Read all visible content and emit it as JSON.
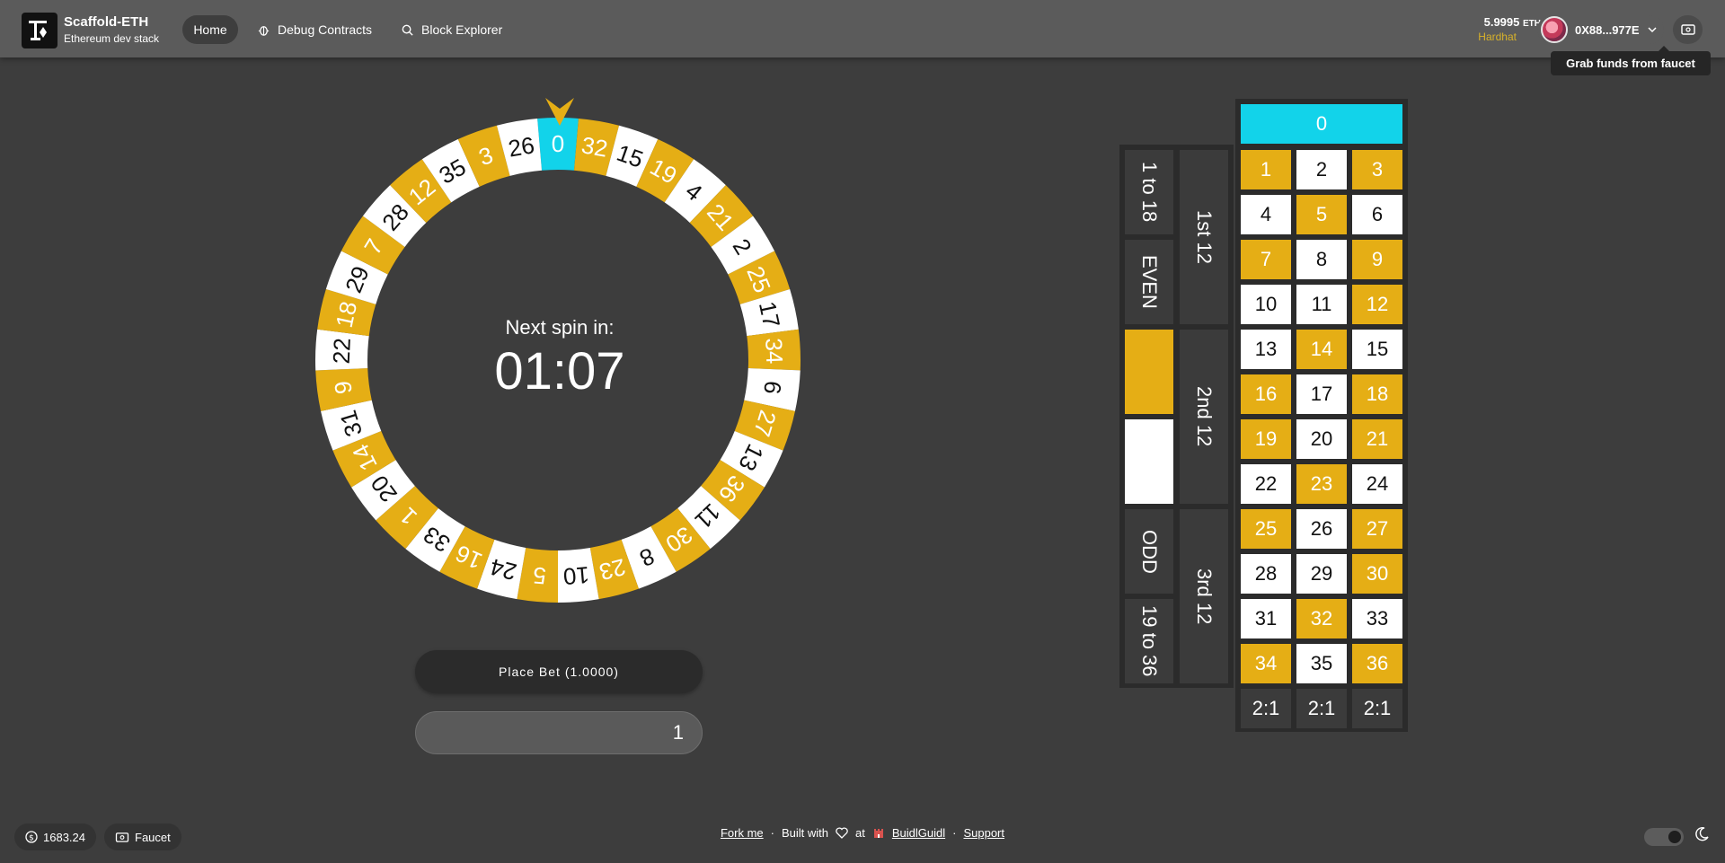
{
  "brand": {
    "title": "Scaffold-ETH",
    "subtitle": "Ethereum dev stack"
  },
  "nav": {
    "home": "Home",
    "debug": "Debug Contracts",
    "explorer": "Block Explorer"
  },
  "wallet": {
    "balance": "5.9995",
    "unit": "ETH",
    "network": "Hardhat",
    "address": "0X88...977E"
  },
  "tooltip": "Grab funds from faucet",
  "game": {
    "next_label": "Next spin in:",
    "timer": "01:07",
    "place_bet": "Place Bet (1.0000)",
    "bet_amount": "1",
    "wheel_numbers": [
      0,
      32,
      15,
      19,
      4,
      21,
      2,
      25,
      17,
      34,
      6,
      27,
      13,
      36,
      11,
      30,
      8,
      23,
      10,
      5,
      24,
      16,
      33,
      1,
      20,
      14,
      31,
      9,
      22,
      18,
      29,
      7,
      28,
      12,
      35,
      3,
      26
    ],
    "zero_label": "0",
    "rows": [
      [
        1,
        2,
        3
      ],
      [
        4,
        5,
        6
      ],
      [
        7,
        8,
        9
      ],
      [
        10,
        11,
        12
      ],
      [
        13,
        14,
        15
      ],
      [
        16,
        17,
        18
      ],
      [
        19,
        20,
        21
      ],
      [
        22,
        23,
        24
      ],
      [
        25,
        26,
        27
      ],
      [
        28,
        29,
        30
      ],
      [
        31,
        32,
        33
      ],
      [
        34,
        35,
        36
      ]
    ],
    "gold_numbers": [
      1,
      3,
      5,
      7,
      9,
      12,
      14,
      16,
      18,
      19,
      21,
      23,
      25,
      27,
      30,
      32,
      34,
      36
    ],
    "column_bets": [
      "2:1",
      "2:1",
      "2:1"
    ],
    "dozens": [
      "1st 12",
      "2nd 12",
      "3rd 12"
    ],
    "outside": {
      "low": "1 to 18",
      "even": "EVEN",
      "odd": "ODD",
      "high": "19 to 36"
    },
    "colors": {
      "gold": "#e5ae15",
      "white": "#ffffff",
      "zero": "#12d3ea"
    }
  },
  "footer": {
    "price": "1683.24",
    "faucet": "Faucet",
    "fork": "Fork me",
    "built_with": "Built with",
    "at": "at",
    "buidl": "BuidlGuidl",
    "support": "Support",
    "sep": "·"
  }
}
